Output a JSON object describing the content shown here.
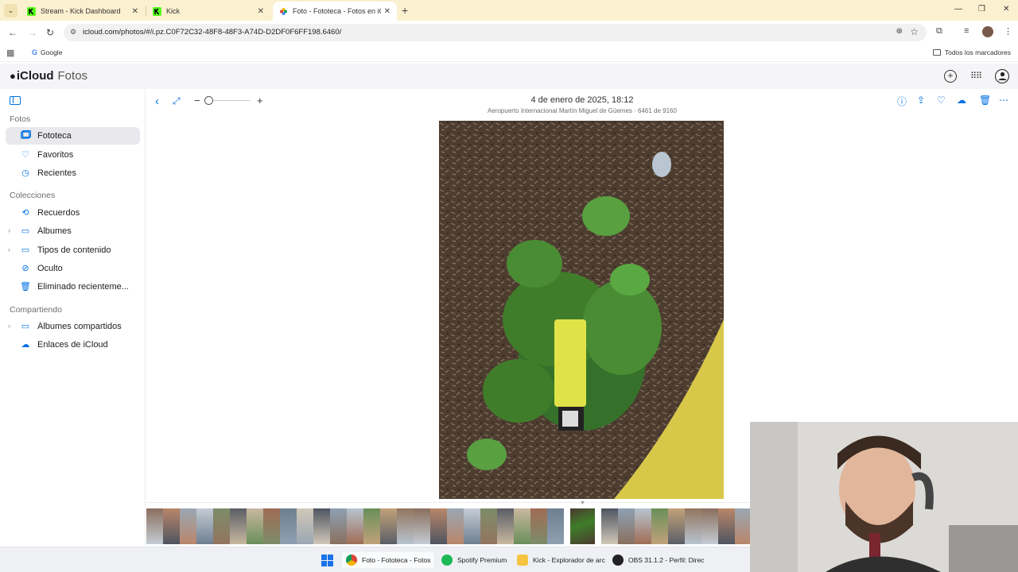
{
  "browser": {
    "tabs": [
      {
        "title": "Stream - Kick Dashboard",
        "active": false,
        "favicon": "kick-icon"
      },
      {
        "title": "Kick",
        "active": false,
        "favicon": "kick-icon"
      },
      {
        "title": "Foto - Fototeca - Fotos en iClo",
        "active": true,
        "favicon": "icloud-photos-icon"
      }
    ],
    "url": "icloud.com/photos/#/i.pz.C0F72C32-48F8-48F3-A74D-D2DF0F6FF198.6460/",
    "bookmarks": {
      "google": "Google",
      "all": "Todos los marcadores"
    }
  },
  "app": {
    "brand_icloud": "iCloud",
    "brand_fotos": "Fotos"
  },
  "sidebar": {
    "fotos_heading": "Fotos",
    "fotos_items": [
      {
        "label": "Fototeca",
        "icon": "photo-library-icon",
        "selected": true
      },
      {
        "label": "Favoritos",
        "icon": "heart-icon"
      },
      {
        "label": "Recientes",
        "icon": "clock-icon"
      }
    ],
    "colecciones_heading": "Colecciones",
    "colecciones_items": [
      {
        "label": "Recuerdos",
        "icon": "memories-icon"
      },
      {
        "label": "Álbumes",
        "icon": "album-icon",
        "expandable": true
      },
      {
        "label": "Tipos de contenido",
        "icon": "media-types-icon",
        "expandable": true
      },
      {
        "label": "Oculto",
        "icon": "eye-slash-icon"
      },
      {
        "label": "Eliminado recienteme...",
        "icon": "trash-icon"
      }
    ],
    "compartiendo_heading": "Compartiendo",
    "compartiendo_items": [
      {
        "label": "Álbumes compartidos",
        "icon": "shared-album-icon",
        "expandable": true
      },
      {
        "label": "Enlaces de iCloud",
        "icon": "icloud-link-icon"
      }
    ]
  },
  "viewer": {
    "date": "4 de enero de 2025, 18:12",
    "subtitle": "Aeropuerto Internacional Martín Miguel de Güemes · 6461 de 9160",
    "zoom_level": 0
  },
  "taskbar": {
    "items": [
      {
        "label": "Foto - Fototeca - Fotos",
        "icon": "chrome-icon",
        "active": true
      },
      {
        "label": "Spotify Premium",
        "icon": "spotify-icon"
      },
      {
        "label": "Kick - Explorador de arc",
        "icon": "folder-icon"
      },
      {
        "label": "OBS 31.1.2 - Perfil: Direc",
        "icon": "obs-icon"
      }
    ]
  },
  "colors": {
    "accent": "#0071e3",
    "tabstrip": "#fbf0cf",
    "selected_item": "#e8e8ed"
  }
}
